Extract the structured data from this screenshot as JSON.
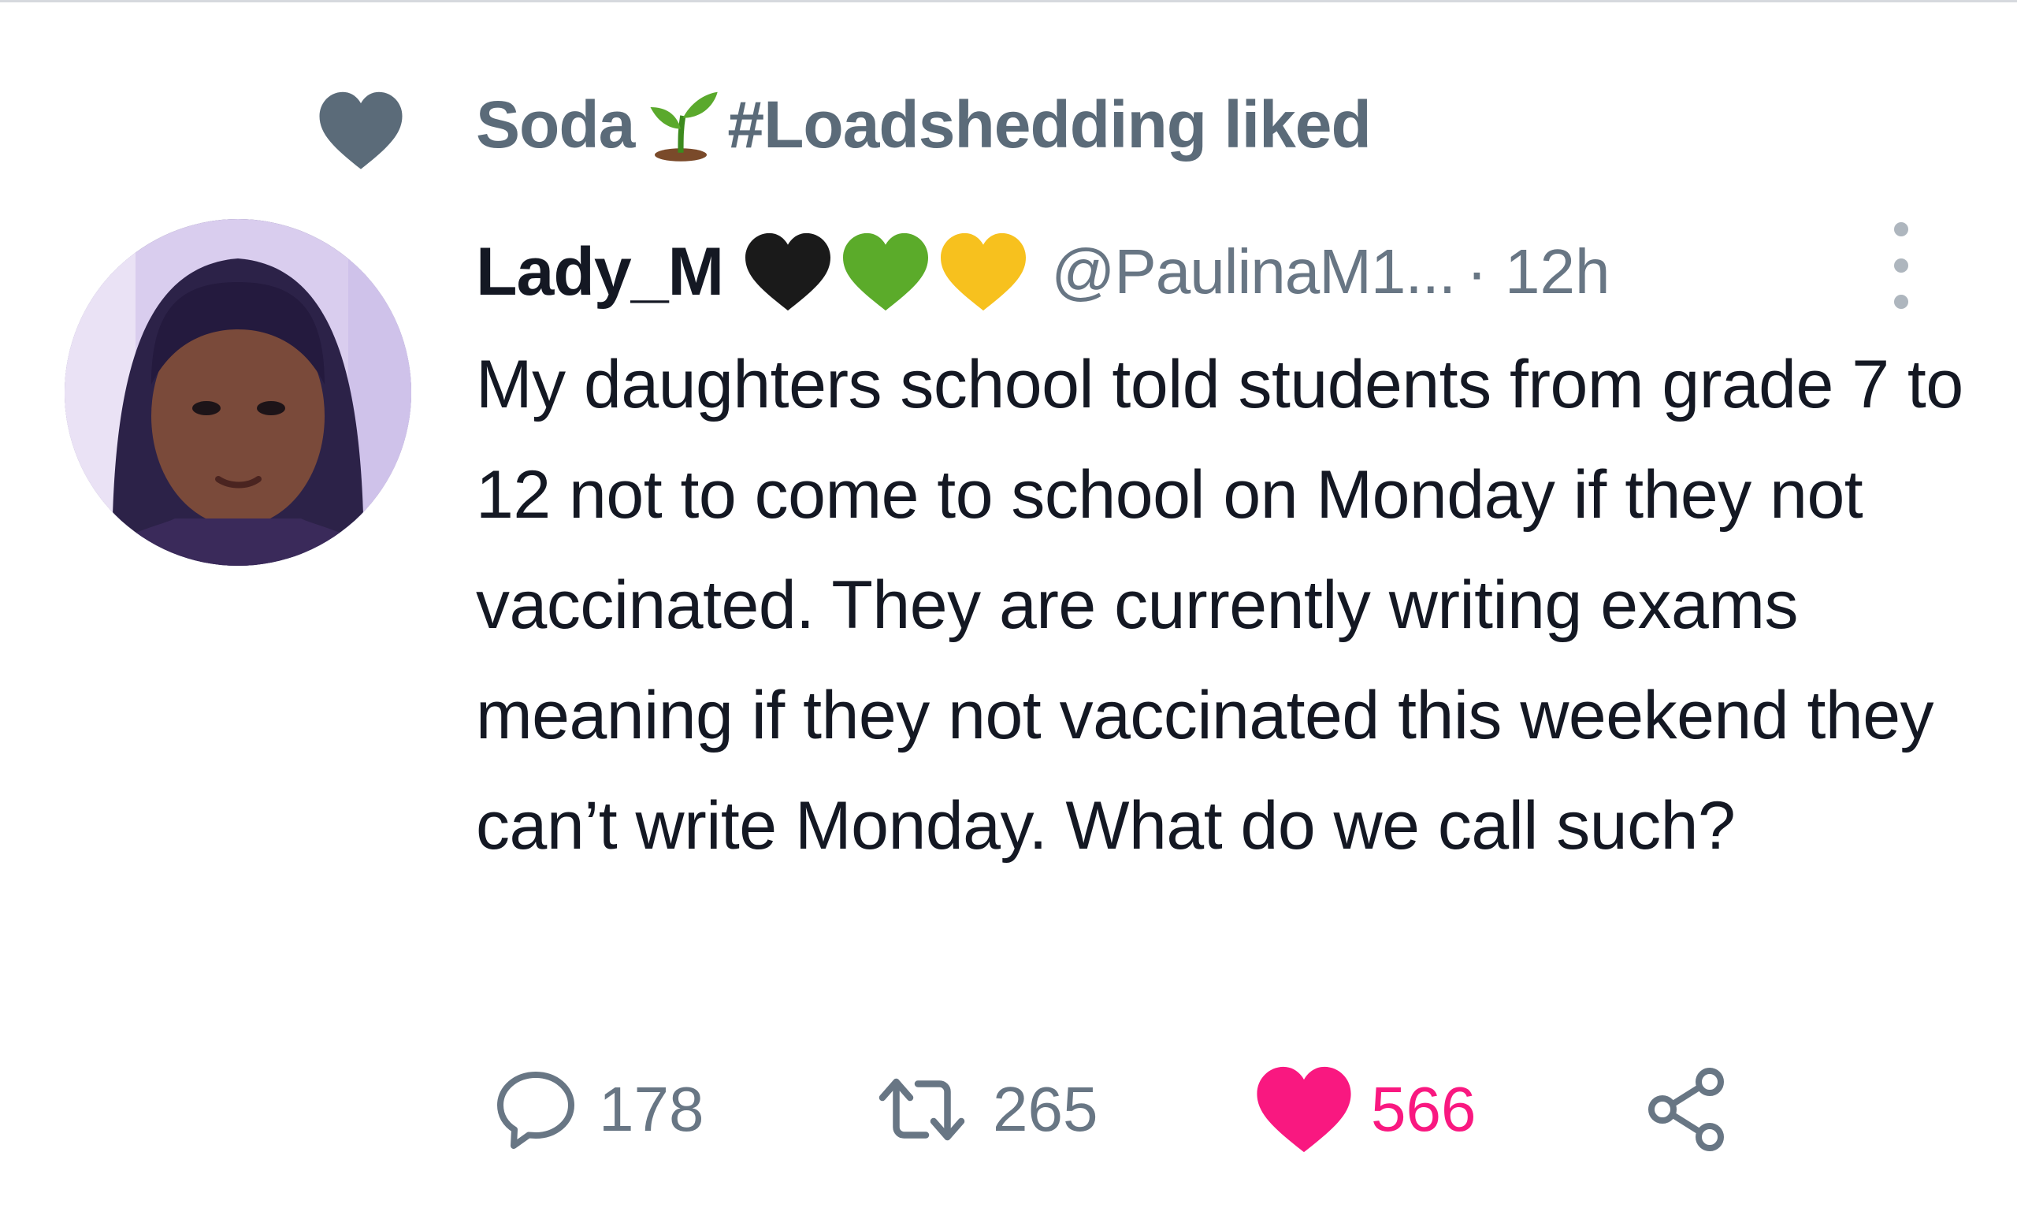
{
  "context": {
    "liker_name": "Soda",
    "liker_suffix": " #Loadshedding liked",
    "icon": "heart-icon"
  },
  "tweet": {
    "display_name": "Lady_M",
    "handle": "@PaulinaM1...",
    "timestamp": "· 12h",
    "text": "My daughters school told students from grade 7 to 12 not to come to school on Monday if they not vaccinated. They are currently writing exams meaning if they not vaccinated this weekend they can’t write Monday. What do we call such?"
  },
  "actions": {
    "replies": "178",
    "retweets": "265",
    "likes": "566"
  },
  "colors": {
    "muted": "#687684",
    "context_heart": "#5b6b79",
    "like_active": "#f91880",
    "text": "#141823"
  }
}
